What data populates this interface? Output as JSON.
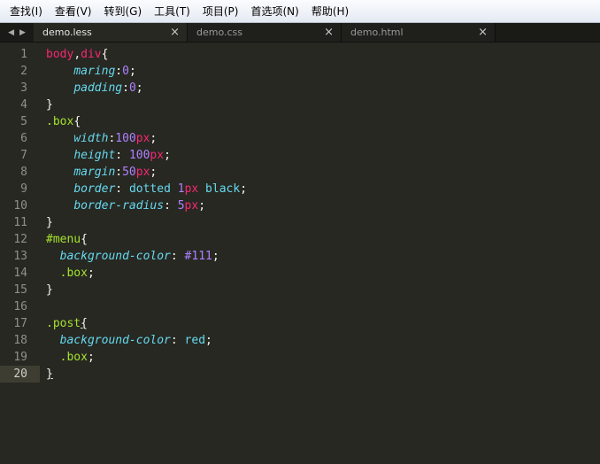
{
  "menu": [
    "查找(I)",
    "查看(V)",
    "转到(G)",
    "工具(T)",
    "项目(P)",
    "首选项(N)",
    "帮助(H)"
  ],
  "tabs": [
    {
      "label": "demo.less",
      "active": true
    },
    {
      "label": "demo.css",
      "active": false
    },
    {
      "label": "demo.html",
      "active": false
    }
  ],
  "icons": {
    "left": "arrow-left-icon",
    "right": "arrow-right-icon",
    "close": "close-icon"
  },
  "current_line": 20,
  "code": [
    [
      [
        "tag",
        "body"
      ],
      [
        "punct",
        ","
      ],
      [
        "tag",
        "div"
      ],
      [
        "punct",
        "{"
      ]
    ],
    [
      [
        "punct",
        "    "
      ],
      [
        "prop",
        "maring"
      ],
      [
        "punct",
        ":"
      ],
      [
        "num",
        "0"
      ],
      [
        "punct",
        ";"
      ]
    ],
    [
      [
        "punct",
        "    "
      ],
      [
        "prop",
        "padding"
      ],
      [
        "punct",
        ":"
      ],
      [
        "num",
        "0"
      ],
      [
        "punct",
        ";"
      ]
    ],
    [
      [
        "punct",
        "}"
      ]
    ],
    [
      [
        "cls",
        ".box"
      ],
      [
        "punct",
        "{"
      ]
    ],
    [
      [
        "punct",
        "    "
      ],
      [
        "prop",
        "width"
      ],
      [
        "punct",
        ":"
      ],
      [
        "num",
        "100"
      ],
      [
        "unit",
        "px"
      ],
      [
        "punct",
        ";"
      ]
    ],
    [
      [
        "punct",
        "    "
      ],
      [
        "prop",
        "height"
      ],
      [
        "punct",
        ": "
      ],
      [
        "num",
        "100"
      ],
      [
        "unit",
        "px"
      ],
      [
        "punct",
        ";"
      ]
    ],
    [
      [
        "punct",
        "    "
      ],
      [
        "prop",
        "margin"
      ],
      [
        "punct",
        ":"
      ],
      [
        "num",
        "50"
      ],
      [
        "unit",
        "px"
      ],
      [
        "punct",
        ";"
      ]
    ],
    [
      [
        "punct",
        "    "
      ],
      [
        "prop",
        "border"
      ],
      [
        "punct",
        ": "
      ],
      [
        "val",
        "dotted "
      ],
      [
        "num",
        "1"
      ],
      [
        "unit",
        "px"
      ],
      [
        "val",
        " black"
      ],
      [
        "punct",
        ";"
      ]
    ],
    [
      [
        "punct",
        "    "
      ],
      [
        "prop",
        "border-radius"
      ],
      [
        "punct",
        ": "
      ],
      [
        "num",
        "5"
      ],
      [
        "unit",
        "px"
      ],
      [
        "punct",
        ";"
      ]
    ],
    [
      [
        "punct",
        "}"
      ]
    ],
    [
      [
        "cls",
        "#menu"
      ],
      [
        "punct",
        "{"
      ]
    ],
    [
      [
        "punct",
        "  "
      ],
      [
        "prop",
        "background-color"
      ],
      [
        "punct",
        ": "
      ],
      [
        "num",
        "#111"
      ],
      [
        "punct",
        ";"
      ]
    ],
    [
      [
        "punct",
        "  "
      ],
      [
        "cls",
        ".box"
      ],
      [
        "punct",
        ";"
      ]
    ],
    [
      [
        "punct",
        "}"
      ]
    ],
    [],
    [
      [
        "cls",
        ".post"
      ],
      [
        "punct",
        "{"
      ]
    ],
    [
      [
        "punct",
        "  "
      ],
      [
        "prop",
        "background-color"
      ],
      [
        "punct",
        ": "
      ],
      [
        "val",
        "red"
      ],
      [
        "punct",
        ";"
      ]
    ],
    [
      [
        "punct",
        "  "
      ],
      [
        "cls",
        ".box"
      ],
      [
        "punct",
        ";"
      ]
    ],
    [
      [
        "punct",
        "}"
      ]
    ]
  ]
}
